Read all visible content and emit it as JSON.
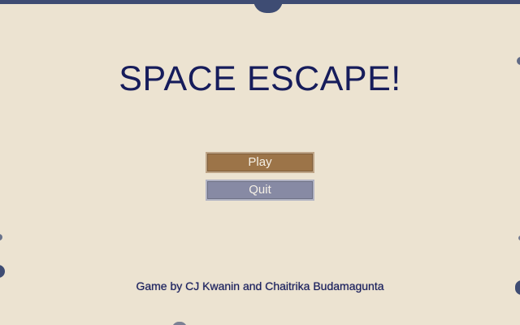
{
  "title": "SPACE ESCAPE!",
  "menu": {
    "play_label": "Play",
    "quit_label": "Quit"
  },
  "credits": "Game by CJ Kwanin and Chaitrika Budamagunta",
  "colors": {
    "background": "#ece3d1",
    "frame": "#3e4c73",
    "title_text": "#161c5b",
    "play_button": "#9c7448",
    "quit_button": "#878aa4",
    "button_text": "#f5f0e6"
  }
}
